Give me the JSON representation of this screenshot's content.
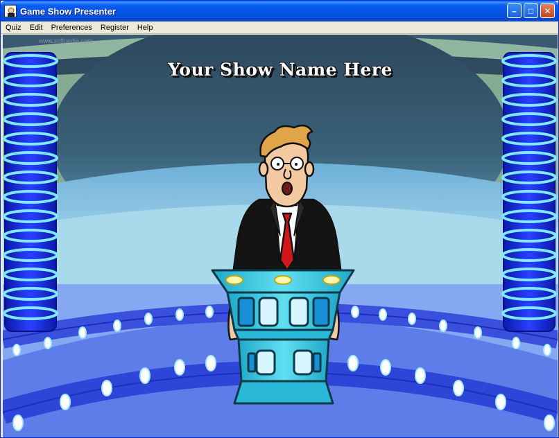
{
  "window": {
    "title": "Game Show Presenter"
  },
  "titlebar_buttons": {
    "minimize": "–",
    "maximize": "□",
    "close": "✕"
  },
  "menu": [
    "Quiz",
    "Edit",
    "Preferences",
    "Register",
    "Help"
  ],
  "stage": {
    "show_name": "Your Show Name Here",
    "watermark": "www.softpedia.com"
  },
  "colors": {
    "pillar": "#1a2fe0",
    "ring": "#7fe8ff",
    "podium": "#35c8e0",
    "backdrop": "#2e4c64",
    "floor": "#7ea6f5"
  },
  "icons": {
    "app": "game-show-icon",
    "host": "host-character"
  }
}
